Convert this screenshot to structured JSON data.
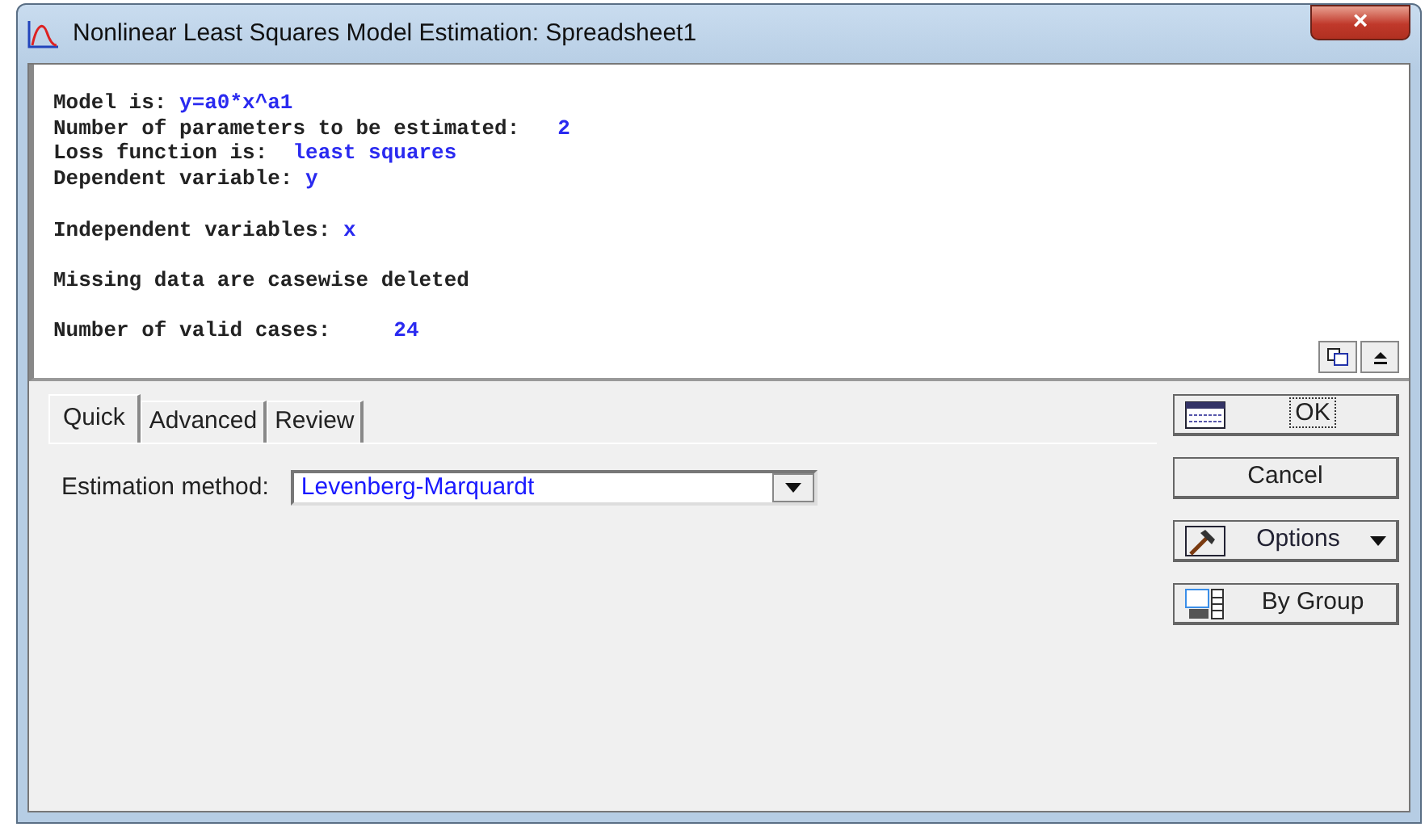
{
  "window": {
    "title": "Nonlinear Least Squares Model Estimation: Spreadsheet1",
    "close": "×"
  },
  "output": [
    {
      "label": "Model is: ",
      "value": "y=a0*x^a1",
      "gap_before": false
    },
    {
      "label": "Number of parameters to be estimated:   ",
      "value": "2",
      "gap_before": false
    },
    {
      "label": "Loss function is:  ",
      "value": "least squares",
      "gap_before": false
    },
    {
      "label": "Dependent variable: ",
      "value": "y",
      "gap_before": false
    },
    {
      "label": "Independent variables: ",
      "value": "x",
      "gap_before": true
    },
    {
      "label": "Missing data are casewise deleted",
      "gap_before": true
    },
    {
      "label": "Number of valid cases:     ",
      "value": "24",
      "gap_before": true
    }
  ],
  "output_tools": [
    {
      "kind": "copy"
    },
    {
      "kind": "up"
    }
  ],
  "tabs": [
    {
      "label": "Quick",
      "selected": true
    },
    {
      "label": "Advanced",
      "selected": false
    },
    {
      "label": "Review",
      "selected": false
    }
  ],
  "estimation": {
    "label": "Estimation method:",
    "value": "Levenberg-Marquardt"
  },
  "buttons": [
    {
      "kind": "ok",
      "label": "OK"
    },
    {
      "kind": "plain",
      "label": "Cancel"
    },
    {
      "kind": "options",
      "label": "Options"
    },
    {
      "kind": "bygroup",
      "label": "By Group"
    }
  ]
}
